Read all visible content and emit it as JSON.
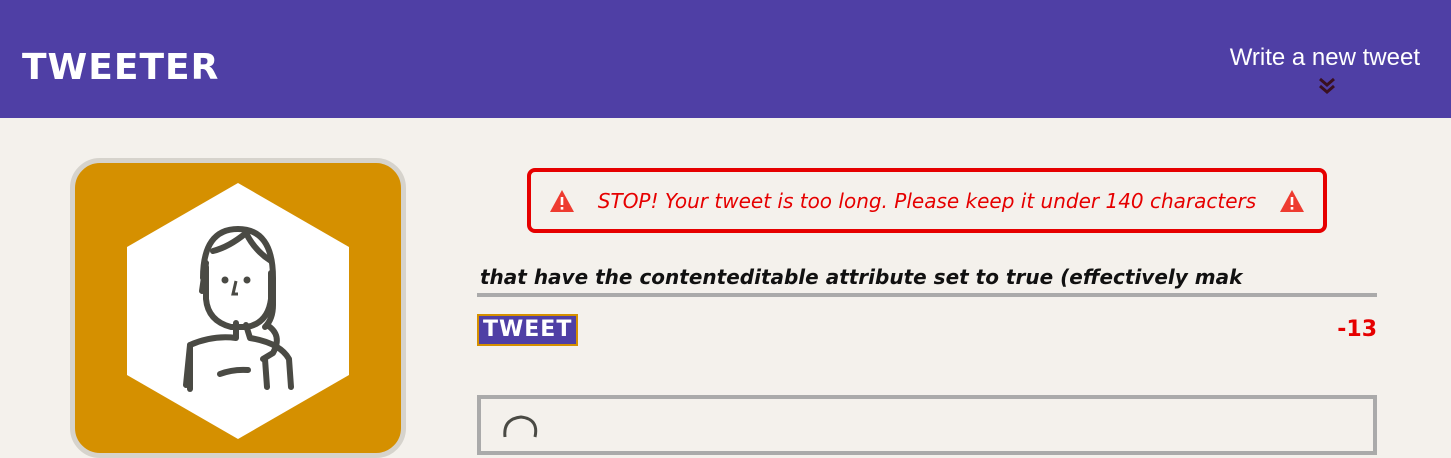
{
  "nav": {
    "brand": "TWEETER",
    "new_tweet_label": "Write a new tweet",
    "new_tweet_icon": "double-chevron-down-icon"
  },
  "profile": {
    "avatar_icon": "woman-avatar-icon",
    "card_color": "#d59000"
  },
  "error": {
    "message": "STOP! Your tweet is too long. Please keep it under 140 characters",
    "icon": "warning-icon",
    "color": "#e60000"
  },
  "composer": {
    "visible_text": "that have the contenteditable attribute set to true (effectively mak",
    "submit_label": "TWEET",
    "counter": "-13"
  },
  "colors": {
    "nav": "#4f3fa5",
    "background": "#f4f1ec",
    "accent": "#d59000"
  }
}
